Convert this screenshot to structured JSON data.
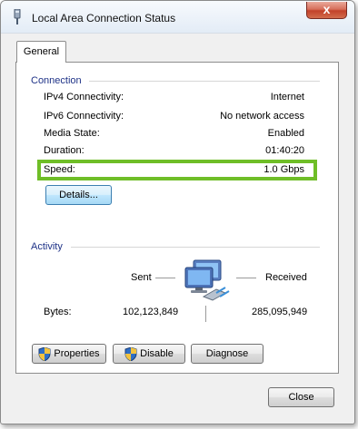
{
  "window": {
    "title": "Local Area Connection Status",
    "close_glyph": "x"
  },
  "tabs": [
    {
      "label": "General"
    }
  ],
  "connection": {
    "heading": "Connection",
    "rows": [
      {
        "label": "IPv4 Connectivity:",
        "value": "Internet"
      },
      {
        "label": "IPv6 Connectivity:",
        "value": "No network access"
      },
      {
        "label": "Media State:",
        "value": "Enabled"
      },
      {
        "label": "Duration:",
        "value": "01:40:20"
      },
      {
        "label": "Speed:",
        "value": "1.0 Gbps"
      }
    ],
    "details_button": "Details...",
    "highlight_color": "#6fbe27"
  },
  "activity": {
    "heading": "Activity",
    "sent_label": "Sent",
    "received_label": "Received",
    "bytes_label": "Bytes:",
    "bytes_sent": "102,123,849",
    "bytes_received": "285,095,949",
    "icon": "network-computers-icon"
  },
  "buttons": {
    "properties": "Properties",
    "disable": "Disable",
    "diagnose": "Diagnose",
    "close": "Close"
  }
}
